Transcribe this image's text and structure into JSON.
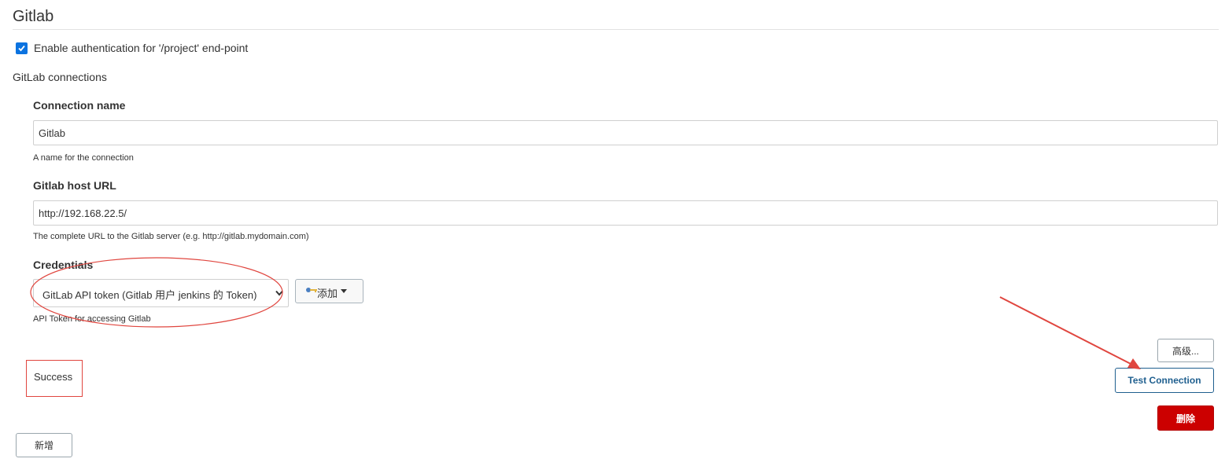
{
  "section": {
    "title": "Gitlab"
  },
  "auth": {
    "label": "Enable authentication for '/project' end-point",
    "checked": true
  },
  "connections": {
    "heading": "GitLab connections",
    "connection_name": {
      "label": "Connection name",
      "value": "Gitlab",
      "help": "A name for the connection"
    },
    "host_url": {
      "label": "Gitlab host URL",
      "value": "http://192.168.22.5/",
      "help": "The complete URL to the Gitlab server (e.g. http://gitlab.mydomain.com)"
    },
    "credentials": {
      "label": "Credentials",
      "selected": "GitLab API token (Gitlab 用户 jenkins 的 Token)",
      "add_label": "添加",
      "help": "API Token for accessing Gitlab"
    },
    "status": "Success",
    "buttons": {
      "advanced": "高级...",
      "test_connection": "Test Connection",
      "delete": "删除"
    }
  },
  "add_new": "新增",
  "colors": {
    "accent": "#0b73e0",
    "test_button": "#1f5f8f",
    "delete_button": "#cc0000",
    "annotation": "#e0463f"
  }
}
